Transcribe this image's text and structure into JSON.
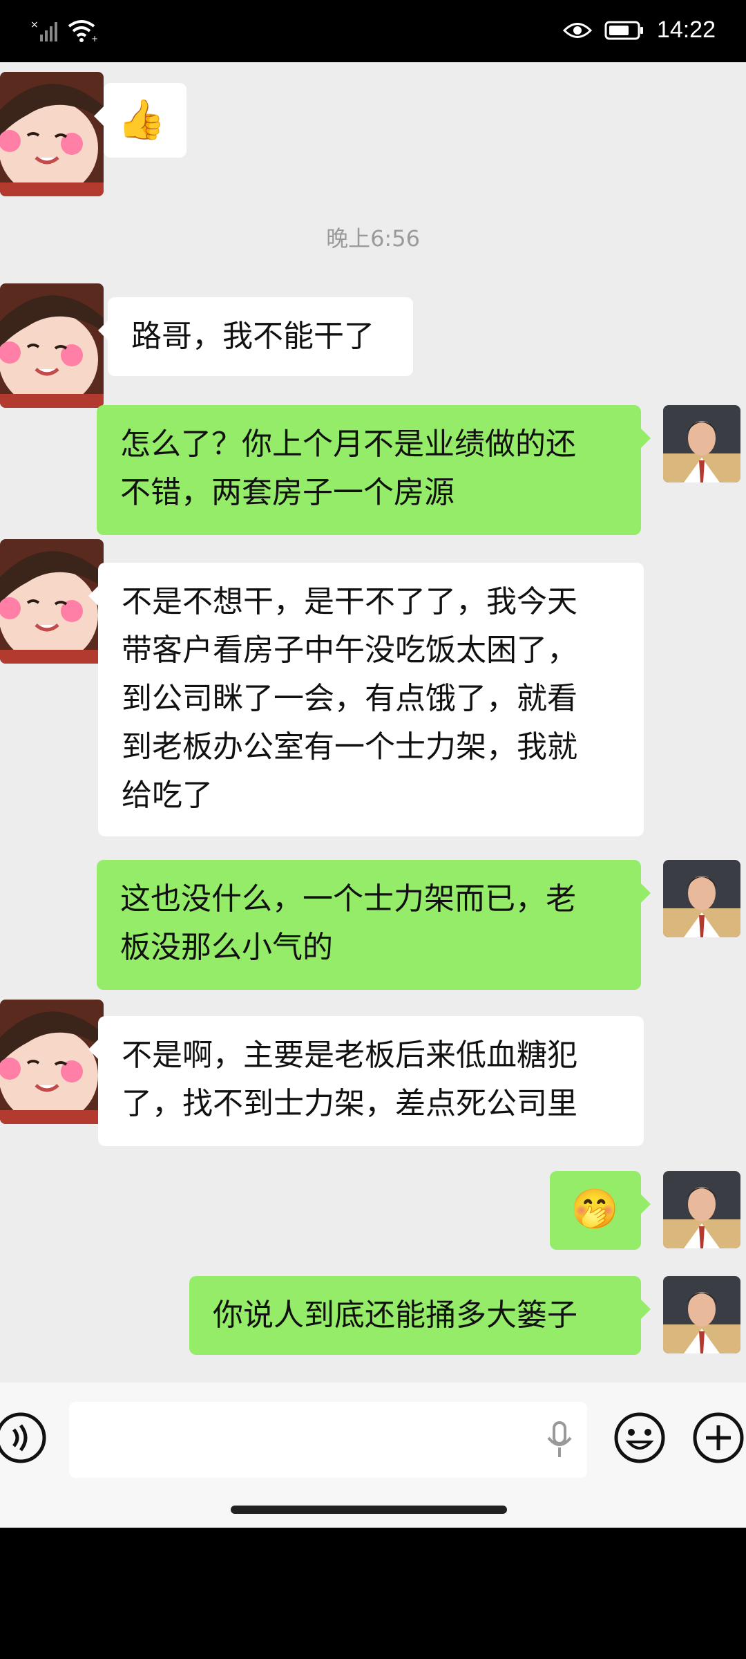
{
  "status_bar": {
    "time": "14:22"
  },
  "messages": {
    "thumbs_up": "👍",
    "timestamp": "晚上6:56",
    "m1": "路哥，我不能干了",
    "m2_line1": "怎么了？你上个月不是业绩做的还",
    "m2_line2": "不错，两套房子一个房源",
    "m3_line1": "不是不想干，是干不了了，我今天",
    "m3_line2": "带客户看房子中午没吃饭太困了，",
    "m3_line3": "到公司眯了一会，有点饿了，就看",
    "m3_line4": "到老板办公室有一个士力架，我就",
    "m3_line5": "给吃了",
    "m4_line1": "这也没什么，一个士力架而已，老",
    "m4_line2": "板没那么小气的",
    "m5_line1": "不是啊，主要是老板后来低血糖犯",
    "m5_line2": "了，找不到士力架，差点死公司里",
    "m6_emoji": "🤭",
    "m7": "你说人到底还能捅多大篓子"
  },
  "colors": {
    "outgoing": "#95ec69",
    "incoming": "#ffffff",
    "background": "#ededed"
  }
}
